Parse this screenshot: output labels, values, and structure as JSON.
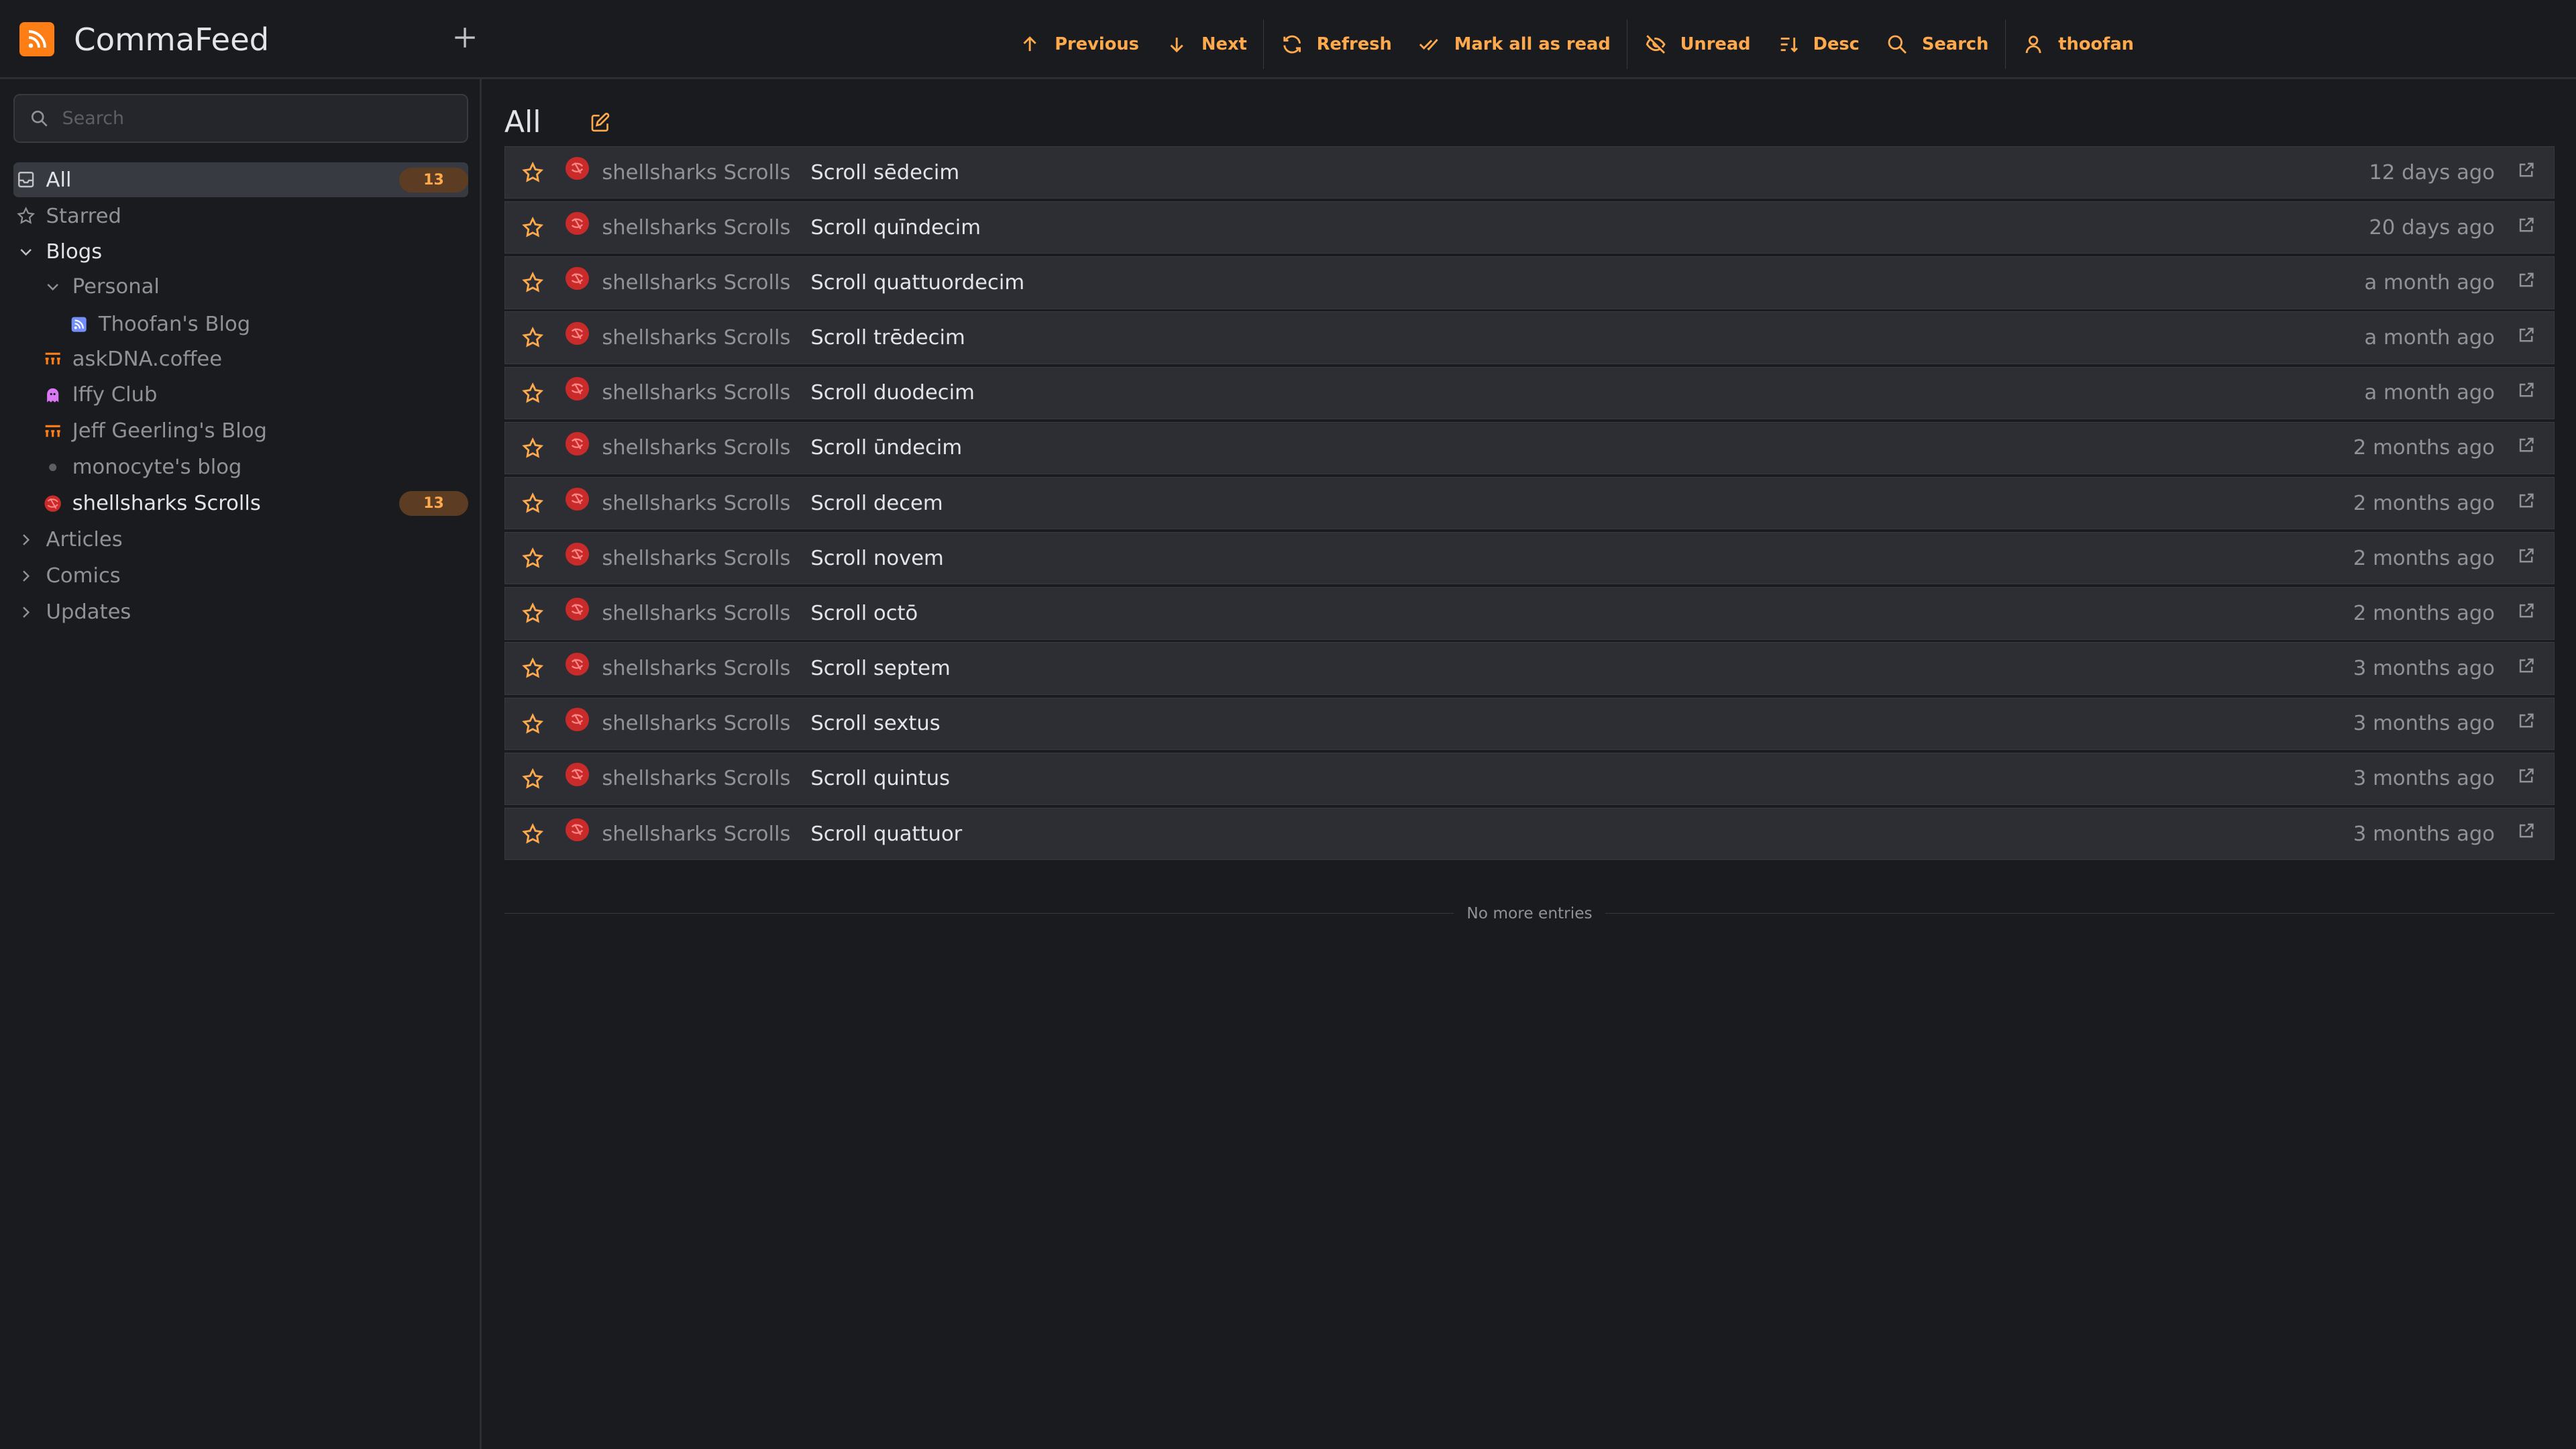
{
  "app": {
    "name": "CommaFeed",
    "logo_icon": "rss-icon",
    "add_icon": "plus-icon"
  },
  "colors": {
    "accent": "#ffa94d",
    "logo": "#fd7e14",
    "background": "#1a1b1e",
    "row": "#2c2e33",
    "badge_bg": "#5c3c22",
    "favicon": "#c92a2a"
  },
  "toolbar": {
    "previous": "Previous",
    "next": "Next",
    "refresh": "Refresh",
    "mark_all_read": "Mark all as read",
    "unread": "Unread",
    "desc": "Desc",
    "search": "Search",
    "user": "thoofan"
  },
  "sidebar": {
    "search_placeholder": "Search",
    "items": [
      {
        "label": "All",
        "icon": "inbox-icon",
        "count": "13"
      },
      {
        "label": "Starred",
        "icon": "star-icon"
      },
      {
        "label": "Blogs",
        "icon": "chevron-down-icon"
      },
      {
        "label": "Personal",
        "icon": "chevron-down-icon"
      },
      {
        "label": "Thoofan's Blog",
        "icon": "blog-favicon-icon"
      },
      {
        "label": "askDNA.coffee",
        "icon": "coffee-favicon-icon"
      },
      {
        "label": "Iffy Club",
        "icon": "ghost-favicon-icon"
      },
      {
        "label": "Jeff Geerling's Blog",
        "icon": "jeff-favicon-icon"
      },
      {
        "label": "monocyte's blog",
        "icon": "dot-icon"
      },
      {
        "label": "shellsharks Scrolls",
        "icon": "shellsharks-favicon-icon",
        "count": "13"
      },
      {
        "label": "Articles",
        "icon": "chevron-right-icon"
      },
      {
        "label": "Comics",
        "icon": "chevron-right-icon"
      },
      {
        "label": "Updates",
        "icon": "chevron-right-icon"
      }
    ]
  },
  "main": {
    "title": "All",
    "edit_icon": "edit-icon",
    "entries": [
      {
        "feed": "shellsharks Scrolls",
        "title": "Scroll sēdecim",
        "date": "12 days ago"
      },
      {
        "feed": "shellsharks Scrolls",
        "title": "Scroll quīndecim",
        "date": "20 days ago"
      },
      {
        "feed": "shellsharks Scrolls",
        "title": "Scroll quattuordecim",
        "date": "a month ago"
      },
      {
        "feed": "shellsharks Scrolls",
        "title": "Scroll trēdecim",
        "date": "a month ago"
      },
      {
        "feed": "shellsharks Scrolls",
        "title": "Scroll duodecim",
        "date": "a month ago"
      },
      {
        "feed": "shellsharks Scrolls",
        "title": "Scroll ūndecim",
        "date": "2 months ago"
      },
      {
        "feed": "shellsharks Scrolls",
        "title": "Scroll decem",
        "date": "2 months ago"
      },
      {
        "feed": "shellsharks Scrolls",
        "title": "Scroll novem",
        "date": "2 months ago"
      },
      {
        "feed": "shellsharks Scrolls",
        "title": "Scroll octō",
        "date": "2 months ago"
      },
      {
        "feed": "shellsharks Scrolls",
        "title": "Scroll septem",
        "date": "3 months ago"
      },
      {
        "feed": "shellsharks Scrolls",
        "title": "Scroll sextus",
        "date": "3 months ago"
      },
      {
        "feed": "shellsharks Scrolls",
        "title": "Scroll quintus",
        "date": "3 months ago"
      },
      {
        "feed": "shellsharks Scrolls",
        "title": "Scroll quattuor",
        "date": "3 months ago"
      }
    ],
    "end_text": "No more entries"
  }
}
